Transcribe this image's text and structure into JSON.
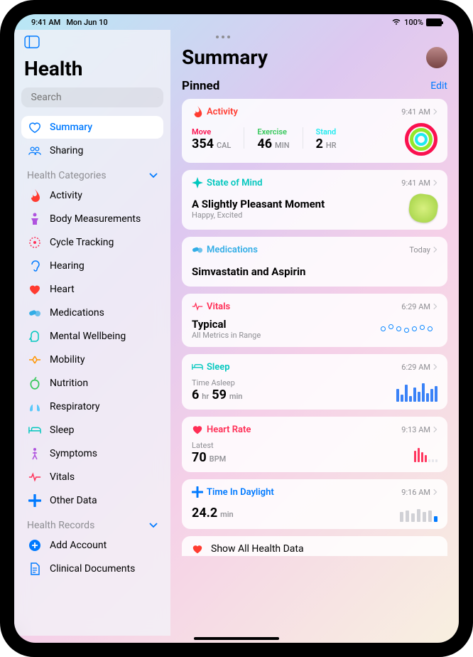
{
  "status": {
    "time": "9:41 AM",
    "date": "Mon Jun 10",
    "battery": "100%"
  },
  "sidebar": {
    "title": "Health",
    "search_placeholder": "Search",
    "items": [
      {
        "label": "Summary"
      },
      {
        "label": "Sharing"
      }
    ],
    "categories_header": "Health Categories",
    "categories": [
      {
        "label": "Activity"
      },
      {
        "label": "Body Measurements"
      },
      {
        "label": "Cycle Tracking"
      },
      {
        "label": "Hearing"
      },
      {
        "label": "Heart"
      },
      {
        "label": "Medications"
      },
      {
        "label": "Mental Wellbeing"
      },
      {
        "label": "Mobility"
      },
      {
        "label": "Nutrition"
      },
      {
        "label": "Respiratory"
      },
      {
        "label": "Sleep"
      },
      {
        "label": "Symptoms"
      },
      {
        "label": "Vitals"
      },
      {
        "label": "Other Data"
      }
    ],
    "records_header": "Health Records",
    "records": [
      {
        "label": "Add Account"
      },
      {
        "label": "Clinical Documents"
      }
    ]
  },
  "content": {
    "title": "Summary",
    "pinned_label": "Pinned",
    "edit_label": "Edit",
    "show_all": "Show All Health Data",
    "cards": {
      "activity": {
        "title": "Activity",
        "time": "9:41 AM",
        "move_label": "Move",
        "move_value": "354",
        "move_unit": "CAL",
        "exercise_label": "Exercise",
        "exercise_value": "46",
        "exercise_unit": "MIN",
        "stand_label": "Stand",
        "stand_value": "2",
        "stand_unit": "HR"
      },
      "state_of_mind": {
        "title": "State of Mind",
        "time": "9:41 AM",
        "headline": "A Slightly Pleasant Moment",
        "sub": "Happy, Excited"
      },
      "medications": {
        "title": "Medications",
        "time": "Today",
        "body": "Simvastatin and Aspirin"
      },
      "vitals": {
        "title": "Vitals",
        "time": "6:29 AM",
        "headline": "Typical",
        "sub": "All Metrics in Range"
      },
      "sleep": {
        "title": "Sleep",
        "time": "6:29 AM",
        "label": "Time Asleep",
        "hours": "6",
        "hours_unit": "hr",
        "minutes": "59",
        "minutes_unit": "min"
      },
      "heart_rate": {
        "title": "Heart Rate",
        "time": "9:13 AM",
        "label": "Latest",
        "value": "70",
        "unit": "BPM"
      },
      "daylight": {
        "title": "Time In Daylight",
        "time": "9:16 AM",
        "value": "24.2",
        "unit": "min"
      }
    }
  }
}
